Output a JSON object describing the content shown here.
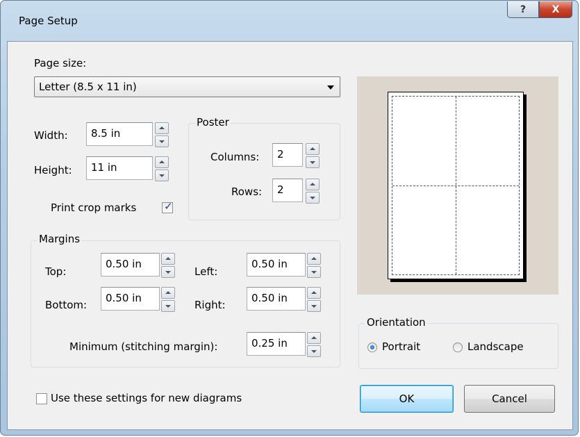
{
  "window": {
    "title": "Page Setup",
    "help_label": "?",
    "close_label": "X"
  },
  "page_size": {
    "label": "Page size:",
    "selected": "Letter  (8.5 x 11 in)"
  },
  "dimensions": {
    "width_label": "Width:",
    "width_value": "8.5 in",
    "height_label": "Height:",
    "height_value": "11 in"
  },
  "crop_marks": {
    "label": "Print crop marks",
    "checked": true
  },
  "poster": {
    "legend": "Poster",
    "columns_label": "Columns:",
    "columns_value": "2",
    "rows_label": "Rows:",
    "rows_value": "2"
  },
  "margins": {
    "legend": "Margins",
    "top_label": "Top:",
    "top_value": "0.50 in",
    "bottom_label": "Bottom:",
    "bottom_value": "0.50 in",
    "left_label": "Left:",
    "left_value": "0.50 in",
    "right_label": "Right:",
    "right_value": "0.50 in",
    "minimum_label": "Minimum (stitching margin):",
    "minimum_value": "0.25 in"
  },
  "orientation": {
    "legend": "Orientation",
    "portrait_label": "Portrait",
    "landscape_label": "Landscape",
    "selected": "Portrait"
  },
  "defaults_checkbox": {
    "label": "Use these settings for new diagrams",
    "checked": false
  },
  "buttons": {
    "ok": "OK",
    "cancel": "Cancel"
  },
  "preview": {
    "columns": 2,
    "rows": 2
  }
}
